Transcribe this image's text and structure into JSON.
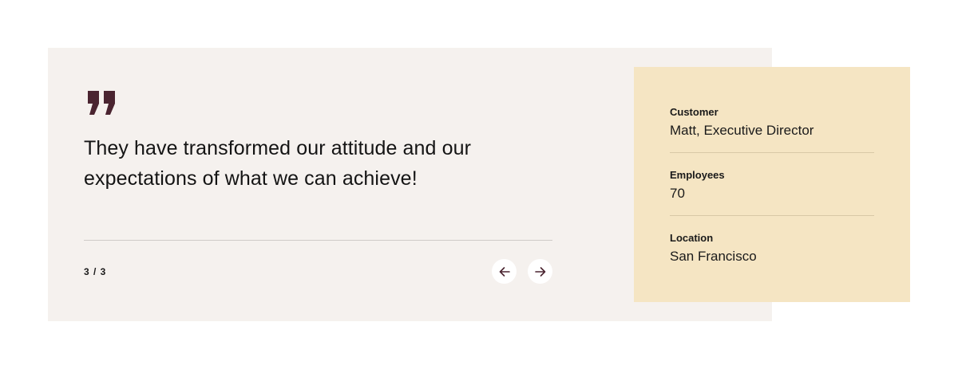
{
  "testimonial": {
    "quote": "They have transformed our attitude and our expectations of what we can achieve!",
    "counter": "3 / 3",
    "quote_icon": "quote-mark-icon",
    "prev_icon": "arrow-left-icon",
    "next_icon": "arrow-right-icon"
  },
  "details": {
    "customer_label": "Customer",
    "customer_value": "Matt, Executive Director",
    "employees_label": "Employees",
    "employees_value": "70",
    "location_label": "Location",
    "location_value": "San Francisco"
  },
  "colors": {
    "card_bg": "#f5f1ee",
    "info_bg": "#f5e5c3",
    "accent": "#4a2430"
  }
}
